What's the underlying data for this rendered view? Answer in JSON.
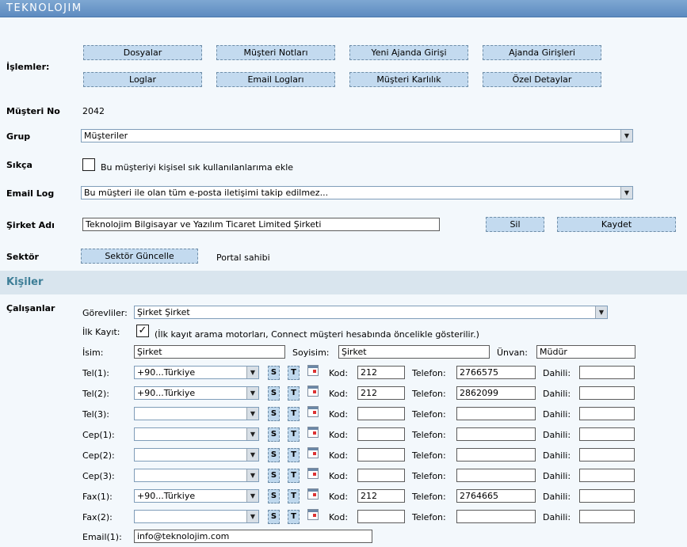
{
  "app": {
    "logo": "TEKNOLOJIM"
  },
  "islemler": {
    "label": "İşlemler:",
    "buttons": [
      "Dosyalar",
      "Müşteri Notları",
      "Yeni Ajanda Girişi",
      "Ajanda Girişleri",
      "Loglar",
      "Email Logları",
      "Müşteri Karlılık",
      "Özel Detaylar"
    ]
  },
  "musteri_no": {
    "label": "Müşteri No",
    "value": "2042"
  },
  "grup": {
    "label": "Grup",
    "value": "Müşteriler"
  },
  "sikca": {
    "label": "Sıkça",
    "checkbox_label": "Bu müşteriyi kişisel sık kullanılanlarıma ekle"
  },
  "email_log": {
    "label": "Email Log",
    "value": "Bu müşteri ile olan tüm e-posta iletişimi takip edilmez..."
  },
  "sirket_adi": {
    "label": "Şirket Adı",
    "value": "Teknolojim Bilgisayar ve Yazılım Ticaret Limited Şirketi",
    "delete_label": "Sil",
    "save_label": "Kaydet"
  },
  "sektor": {
    "label": "Sektör",
    "button_label": "Sektör Güncelle",
    "value": "Portal sahibi"
  },
  "kisiler": {
    "title": "Kişiler"
  },
  "calisanlar": {
    "label": "Çalışanlar",
    "gorevliler_label": "Görevliler:",
    "gorevliler_value": "Şirket Şirket",
    "ilk_kayit_label": "İlk Kayıt:",
    "ilk_kayit_checked": "✓",
    "ilk_kayit_note": "(İlk kayıt arama motorları, Connect müşteri hesabında öncelikle gösterilir.)",
    "isim_label": "İsim:",
    "isim_value": "Şirket",
    "soyisim_label": "Soyisim:",
    "soyisim_value": "Şirket",
    "unvan_label": "Ünvan:",
    "unvan_value": "Müdür",
    "s_label": "S",
    "t_label": "T",
    "kod_label": "Kod:",
    "telefon_label": "Telefon:",
    "dahili_label": "Dahili:",
    "phones": [
      {
        "label": "Tel(1):",
        "country": "+90...Türkiye",
        "kod": "212",
        "telefon": "2766575",
        "dahili": ""
      },
      {
        "label": "Tel(2):",
        "country": "+90...Türkiye",
        "kod": "212",
        "telefon": "2862099",
        "dahili": ""
      },
      {
        "label": "Tel(3):",
        "country": "",
        "kod": "",
        "telefon": "",
        "dahili": ""
      },
      {
        "label": "Cep(1):",
        "country": "",
        "kod": "",
        "telefon": "",
        "dahili": ""
      },
      {
        "label": "Cep(2):",
        "country": "",
        "kod": "",
        "telefon": "",
        "dahili": ""
      },
      {
        "label": "Cep(3):",
        "country": "",
        "kod": "",
        "telefon": "",
        "dahili": ""
      },
      {
        "label": "Fax(1):",
        "country": "+90...Türkiye",
        "kod": "212",
        "telefon": "2764665",
        "dahili": ""
      },
      {
        "label": "Fax(2):",
        "country": "",
        "kod": "",
        "telefon": "",
        "dahili": ""
      }
    ],
    "email_label": "Email(1):",
    "email_value": "info@teknolojim.com"
  }
}
